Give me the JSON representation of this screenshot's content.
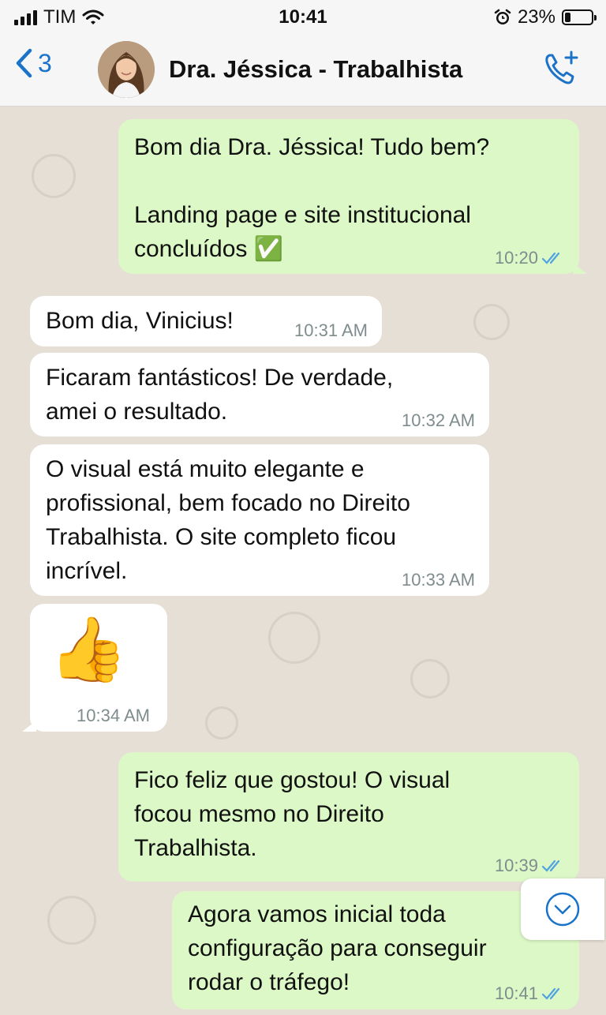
{
  "status_bar": {
    "carrier": "TIM",
    "time": "10:41",
    "battery": "23%",
    "battery_level": 0.23
  },
  "header": {
    "back_count": "3",
    "contact_name": "Dra. Jéssica - Trabalhista"
  },
  "messages": [
    {
      "direction": "out",
      "text": "Bom dia Dra. Jéssica! Tudo bem?\n\nLanding page e site institucional\nconcluídos ✅",
      "time": "10:20",
      "read": true
    },
    {
      "direction": "in",
      "text": "Bom dia, Vinicius!",
      "time": "10:31 AM"
    },
    {
      "direction": "in",
      "text": "Ficaram fantásticos! De verdade,\namei o resultado.",
      "time": "10:32 AM"
    },
    {
      "direction": "in",
      "text": "O visual está muito elegante e\nprofissional, bem focado no Direito\nTrabalhista. O site completo ficou\nincrível.",
      "time": "10:33 AM"
    },
    {
      "direction": "in",
      "text": "👍",
      "time": "10:34 AM",
      "emoji": true
    },
    {
      "direction": "out",
      "text": "Fico feliz que gostou! O visual\nfocou mesmo no Direito\nTrabalhista.",
      "time": "10:39",
      "read": true
    },
    {
      "direction": "out",
      "text": "Agora vamos inicial toda\nconfiguração para conseguir\nrodar o tráfego!",
      "time": "10:41",
      "read": true
    }
  ],
  "colors": {
    "outgoing_bubble": "#dcf8c6",
    "incoming_bubble": "#ffffff",
    "chat_background": "#e6dfd5",
    "accent": "#1a73c9",
    "read_ticks": "#4fa3e0"
  },
  "icons": [
    "signal-icon",
    "wifi-icon",
    "alarm-icon",
    "battery-icon",
    "back-chevron-icon",
    "add-call-icon",
    "read-receipt-icon",
    "scroll-down-icon"
  ]
}
